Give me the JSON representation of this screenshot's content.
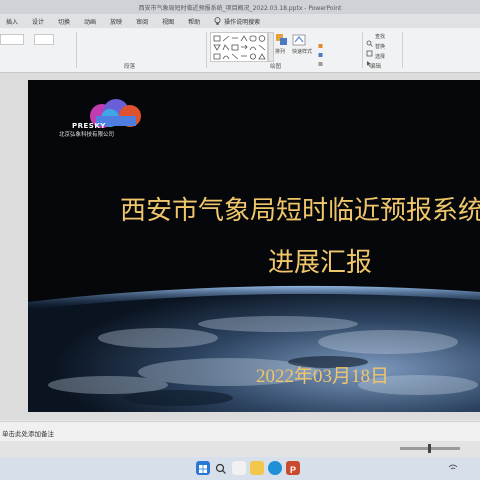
{
  "window": {
    "title": "西安市气象局短时临近预报系统_项目概况_2022.03.18.pptx - PowerPoint"
  },
  "menu": {
    "items": [
      "插入",
      "设计",
      "切换",
      "动画",
      "放映",
      "审阅",
      "视图",
      "帮助"
    ],
    "search_hint": "操作说明搜索"
  },
  "ribbon": {
    "groups": [
      "段落",
      "绘图",
      "编辑"
    ],
    "buttons": {
      "arrange": "排列",
      "quick_styles": "快速样式",
      "find": "查找",
      "replace": "替换",
      "select": "选择"
    }
  },
  "slide": {
    "logo_brand": "PRESKY",
    "company": "北京弘象科技有限公司",
    "title_line1": "西安市气象局短时临近预报系统",
    "title_line2": "进展汇报",
    "date": "2022年03月18日"
  },
  "notes": {
    "placeholder": "单击此处添加备注"
  },
  "colors": {
    "title_gold": "#f0c66a",
    "slide_bg": "#06070b",
    "taskbar": "#d7e0ea"
  },
  "taskbar": {
    "icons": [
      "windows-start-icon",
      "search-icon",
      "folder-icon",
      "edge-icon",
      "store-icon",
      "powerpoint-icon"
    ]
  }
}
